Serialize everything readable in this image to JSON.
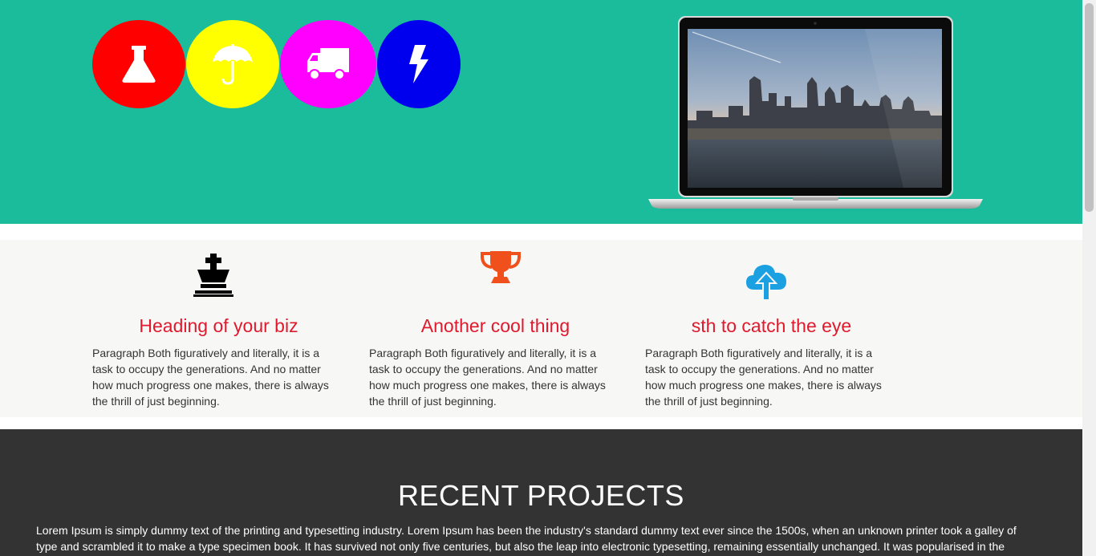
{
  "hero": {
    "icons": [
      {
        "name": "flask-icon",
        "color": "#ff0000"
      },
      {
        "name": "umbrella-icon",
        "color": "#ffff00"
      },
      {
        "name": "truck-icon",
        "color": "#ff00ff"
      },
      {
        "name": "lightning-icon",
        "color": "#0000ee"
      }
    ],
    "background": "#1abc9c",
    "laptop_image": "laptop-city-skyline"
  },
  "features": [
    {
      "icon": "chess-king-icon",
      "icon_color": "#000000",
      "title": "Heading of your biz",
      "text": "Paragraph Both figuratively and literally, it is a task to occupy the generations.  And no matter how much progress one makes, there is always the thrill of just beginning."
    },
    {
      "icon": "trophy-icon",
      "icon_color": "#f0501c",
      "title": "Another cool thing",
      "text": "Paragraph Both figuratively and literally, it is a task to occupy the generations.  And no matter how much progress one makes, there is always the thrill of just beginning."
    },
    {
      "icon": "cloud-upload-icon",
      "icon_color": "#1ba1e2",
      "title": "sth to catch the eye",
      "text": "Paragraph Both figuratively and literally, it is a task to occupy the generations.  And no matter how much progress one makes, there is always the thrill of just beginning."
    }
  ],
  "projects": {
    "title": "RECENT PROJECTS",
    "text": "Lorem Ipsum is simply dummy text of the printing and typesetting industry. Lorem Ipsum has been the industry's standard dummy text ever since the 1500s, when an unknown printer took a galley of type and scrambled it to make a type specimen book. It has survived not only five centuries, but also the leap into electronic typesetting, remaining essentially unchanged. It was popularised in the"
  }
}
